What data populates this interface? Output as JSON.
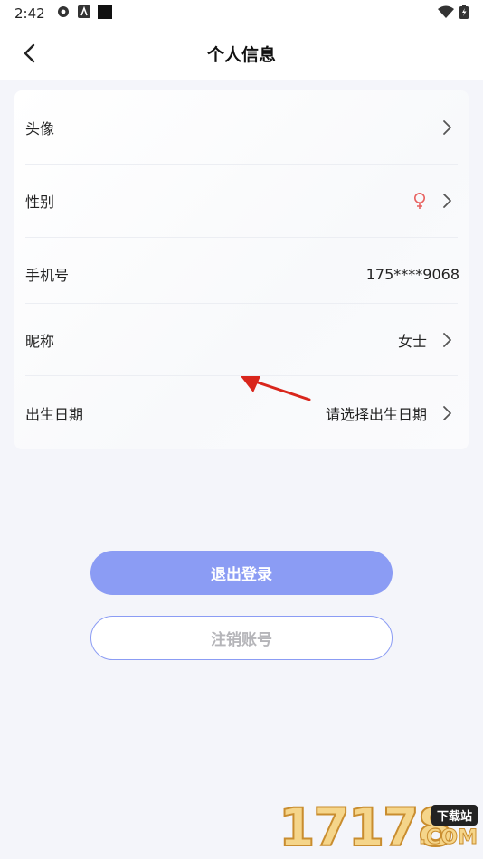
{
  "status_bar": {
    "time": "2:42",
    "left_icons": [
      "gear-icon",
      "a-icon",
      "square-icon"
    ],
    "right_icons": [
      "wifi-icon",
      "battery-icon"
    ]
  },
  "header": {
    "title": "个人信息",
    "back_icon": "chevron-left-icon"
  },
  "profile_rows": [
    {
      "label": "头像",
      "value": "",
      "chevron": true
    },
    {
      "label": "性别",
      "value": "",
      "icon": "female-icon",
      "chevron": true
    },
    {
      "label": "手机号",
      "value": "175****9068",
      "chevron": false
    },
    {
      "label": "昵称",
      "value": "女士",
      "chevron": true
    },
    {
      "label": "出生日期",
      "value": "请选择出生日期",
      "chevron": true
    }
  ],
  "actions": {
    "logout_label": "退出登录",
    "deactivate_label": "注销账号"
  },
  "watermark": {
    "number": "17178",
    "tag": "下载站",
    "domain": ".COM"
  },
  "colors": {
    "accent": "#8b9cf4",
    "background": "#f4f5fa",
    "female_icon": "#e8615f",
    "annotation_arrow": "#d9261c"
  }
}
